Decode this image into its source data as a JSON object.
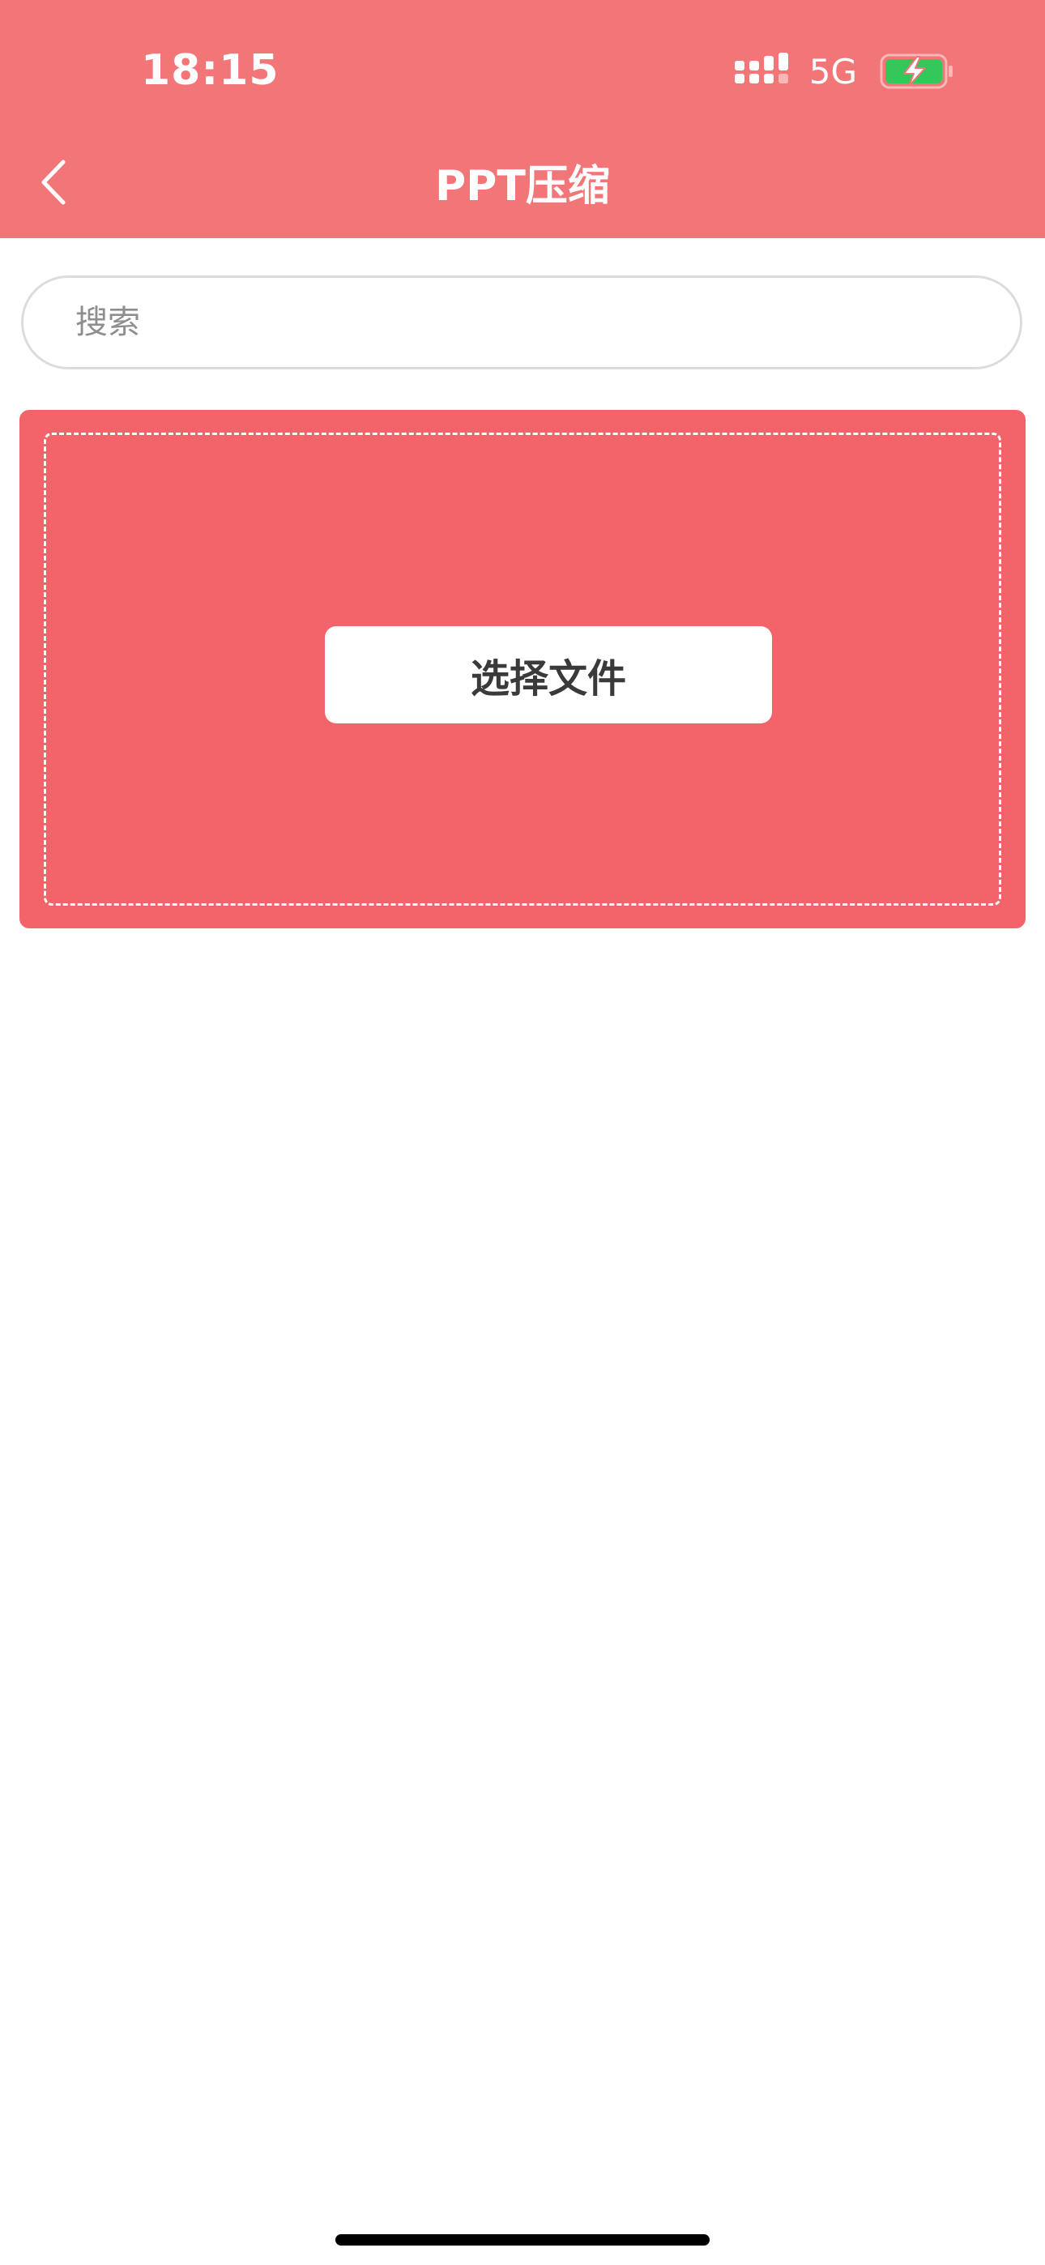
{
  "status_bar": {
    "time": "18:15",
    "network": "5G",
    "signal_icon": "signal-bars-icon",
    "battery_icon": "battery-charging-icon"
  },
  "nav": {
    "back_icon": "chevron-left-icon",
    "title": "PPT压缩"
  },
  "search": {
    "placeholder": "搜索",
    "value": ""
  },
  "upload": {
    "button_label": "选择文件"
  },
  "colors": {
    "header_bg": "#f27678",
    "card_bg": "#f2646a",
    "battery_fill": "#34c759"
  }
}
